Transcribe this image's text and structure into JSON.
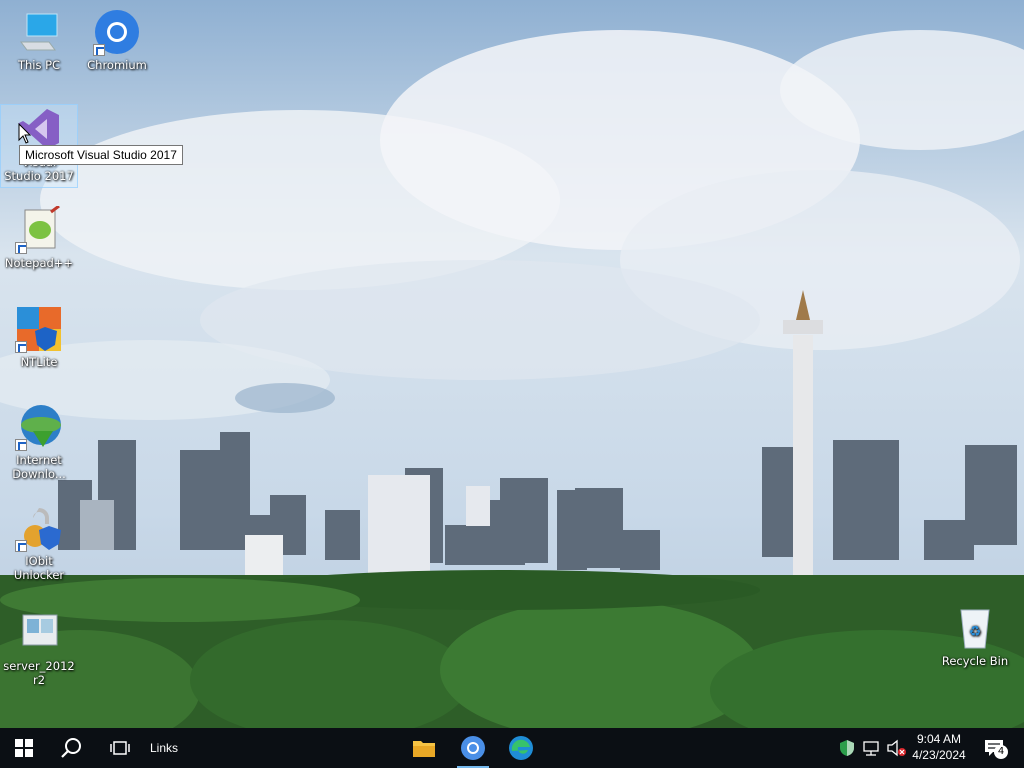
{
  "desktop": {
    "icons": [
      {
        "label": "This PC"
      },
      {
        "label": "Chromium"
      },
      {
        "label": "Visual Studio 2017"
      },
      {
        "label": "Notepad++"
      },
      {
        "label": "NTLite"
      },
      {
        "label": "Internet Downlo..."
      },
      {
        "label": "IObit Unlocker"
      },
      {
        "label": "server_2012r2"
      },
      {
        "label": "Recycle Bin"
      }
    ],
    "tooltip": "Microsoft Visual Studio 2017"
  },
  "taskbar": {
    "links_label": "Links",
    "pinned": [
      "file-explorer",
      "chromium",
      "edge"
    ],
    "clock": {
      "time": "9:04 AM",
      "date": "4/23/2024"
    },
    "notification_count": "4"
  },
  "colors": {
    "taskbar": "#0b0f14",
    "sky": "#c9d9ea",
    "accent": "#76b9ed"
  }
}
